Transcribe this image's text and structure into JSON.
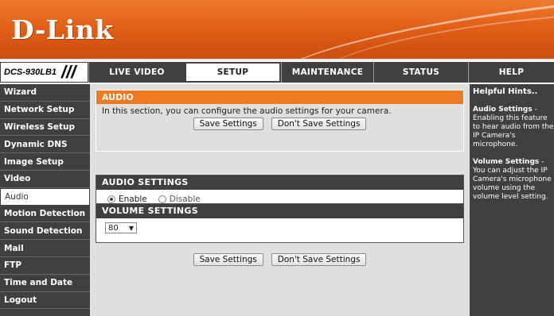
{
  "brand": {
    "logo_text": "D-Link",
    "model": "DCS-930LB1",
    "slashes": "///"
  },
  "nav": {
    "tabs": [
      {
        "label": "LIVE VIDEO",
        "active": false
      },
      {
        "label": "SETUP",
        "active": true
      },
      {
        "label": "MAINTENANCE",
        "active": false
      },
      {
        "label": "STATUS",
        "active": false
      },
      {
        "label": "HELP",
        "active": false
      }
    ]
  },
  "sidebar": {
    "items": [
      {
        "label": "Wizard",
        "active": false
      },
      {
        "label": "Network Setup",
        "active": false
      },
      {
        "label": "Wireless Setup",
        "active": false
      },
      {
        "label": "Dynamic DNS",
        "active": false
      },
      {
        "label": "Image Setup",
        "active": false
      },
      {
        "label": "Video",
        "active": false
      },
      {
        "label": "Audio",
        "active": true
      },
      {
        "label": "Motion Detection",
        "active": false
      },
      {
        "label": "Sound Detection",
        "active": false
      },
      {
        "label": "Mail",
        "active": false
      },
      {
        "label": "FTP",
        "active": false
      },
      {
        "label": "Time and Date",
        "active": false
      },
      {
        "label": "Logout",
        "active": false
      }
    ]
  },
  "audio_section": {
    "title": "AUDIO",
    "description": "In this section, you can configure the audio settings for your camera.",
    "save_label": "Save Settings",
    "dont_save_label": "Don't Save Settings"
  },
  "audio_settings": {
    "title": "AUDIO SETTINGS",
    "enable_label": "Enable",
    "disable_label": "Disable",
    "selected": "Enable"
  },
  "volume_settings": {
    "title": "VOLUME SETTINGS",
    "value": "80"
  },
  "footer_buttons": {
    "save_label": "Save Settings",
    "dont_save_label": "Don't Save Settings"
  },
  "hints": {
    "title": "Helpful Hints..",
    "audio_title": "Audio Settings",
    "audio_text": " - Enabling this feature to hear audio from the IP Camera's microphone.",
    "volume_title": "Volume Settings",
    "volume_text": " - You can adjust the IP Camera's microphone volume using the volume level setting."
  },
  "colors": {
    "orange": "#f07a1f",
    "dark": "#404040",
    "panel_bg": "#dfdfdf"
  }
}
